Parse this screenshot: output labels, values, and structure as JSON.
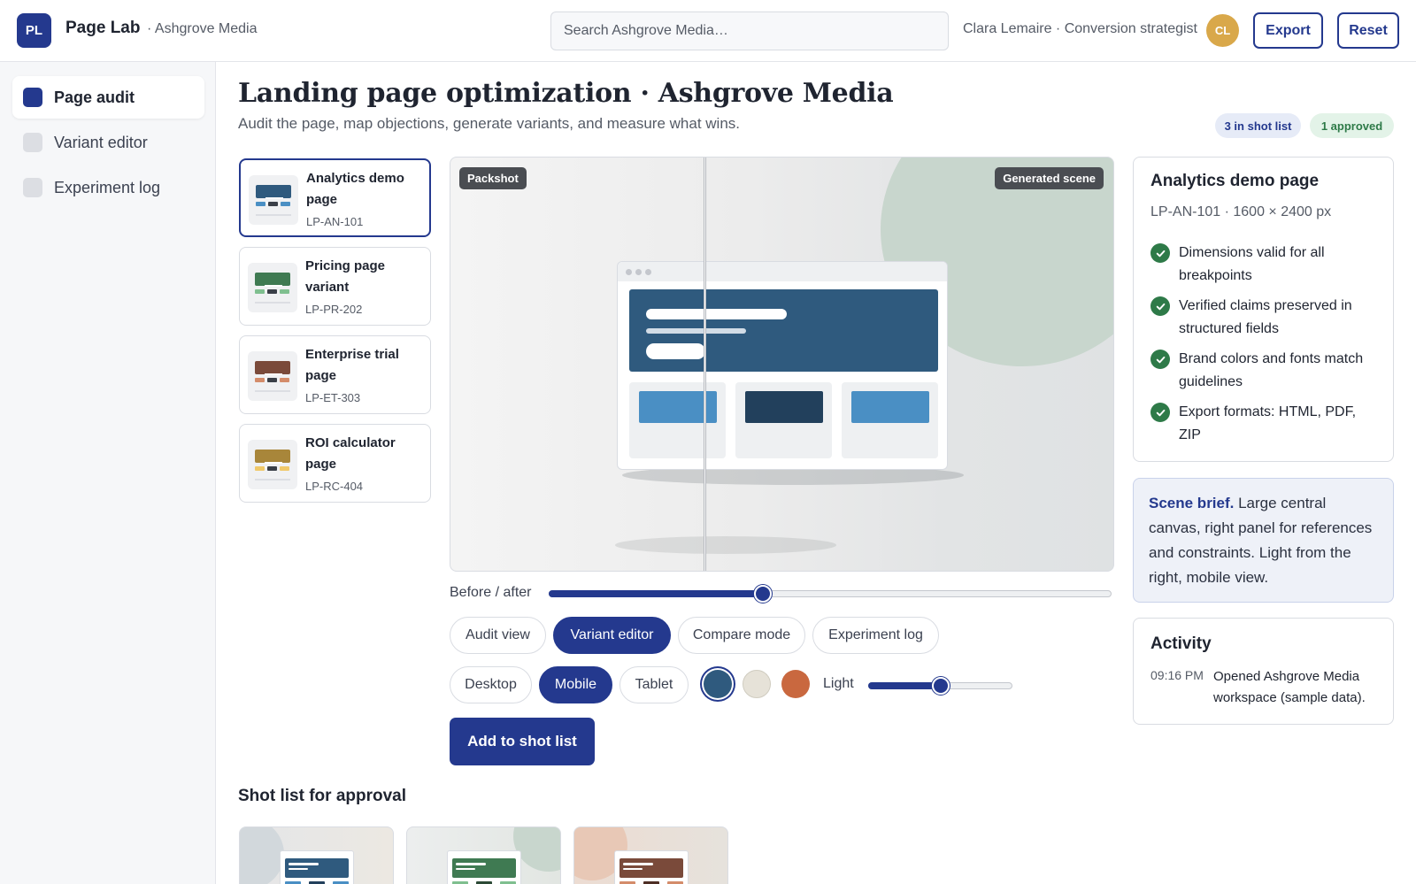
{
  "app": {
    "logo_text": "PL",
    "title": "Page Lab",
    "workspace": "· Ashgrove Media",
    "search_placeholder": "Search Ashgrove Media…",
    "user": "Clara Lemaire · Conversion strategist",
    "avatar_initials": "CL",
    "export_label": "Export",
    "reset_label": "Reset"
  },
  "sidebar": {
    "items": [
      {
        "label": "Page audit",
        "active": true
      },
      {
        "label": "Variant editor",
        "active": false
      },
      {
        "label": "Experiment log",
        "active": false
      }
    ]
  },
  "header": {
    "title": "Landing page optimization · Ashgrove Media",
    "subtitle": "Audit the page, map objections, generate variants, and measure what wins.",
    "badge_shot": "3 in shot list",
    "badge_approved": "1 approved"
  },
  "pages": [
    {
      "name": "Analytics demo page",
      "id": "LP-AN-101",
      "color": "#2f5a7e",
      "accent": "#4a8fc4",
      "selected": true
    },
    {
      "name": "Pricing page variant",
      "id": "LP-PR-202",
      "color": "#3f7a52",
      "accent": "#7fbf8f",
      "selected": false
    },
    {
      "name": "Enterprise trial page",
      "id": "LP-ET-303",
      "color": "#7a4a3a",
      "accent": "#d48c6a",
      "selected": false
    },
    {
      "name": "ROI calculator page",
      "id": "LP-RC-404",
      "color": "#a8863a",
      "accent": "#f0c96a",
      "selected": false
    }
  ],
  "canvas": {
    "tag_left": "Packshot",
    "tag_right": "Generated scene"
  },
  "controls": {
    "before_after_label": "Before / after",
    "before_after_value": 0.38,
    "modes": [
      {
        "label": "Audit view",
        "active": false
      },
      {
        "label": "Variant editor",
        "active": true
      },
      {
        "label": "Compare mode",
        "active": false
      },
      {
        "label": "Experiment log",
        "active": false
      }
    ],
    "devices": [
      {
        "label": "Desktop",
        "active": false
      },
      {
        "label": "Mobile",
        "active": true
      },
      {
        "label": "Tablet",
        "active": false
      }
    ],
    "swatches": [
      "#2f5a7e",
      "#e6e2d8",
      "#c9683f"
    ],
    "light_label": "Light",
    "light_value": 0.5,
    "add_label": "Add to shot list"
  },
  "shot_list": {
    "title": "Shot list for approval"
  },
  "detail": {
    "title": "Analytics demo page",
    "meta": "LP-AN-101 · 1600 × 2400 px",
    "checks": [
      "Dimensions valid for all breakpoints",
      "Verified claims preserved in structured fields",
      "Brand colors and fonts match guidelines",
      "Export formats: HTML, PDF, ZIP"
    ]
  },
  "brief": {
    "lead": "Scene brief.",
    "text": " Large central canvas, right panel for references and constraints. Light from the right, mobile view."
  },
  "activity": {
    "title": "Activity",
    "time": "09:16 PM",
    "text": "Opened Ashgrove Media workspace (sample data)."
  }
}
